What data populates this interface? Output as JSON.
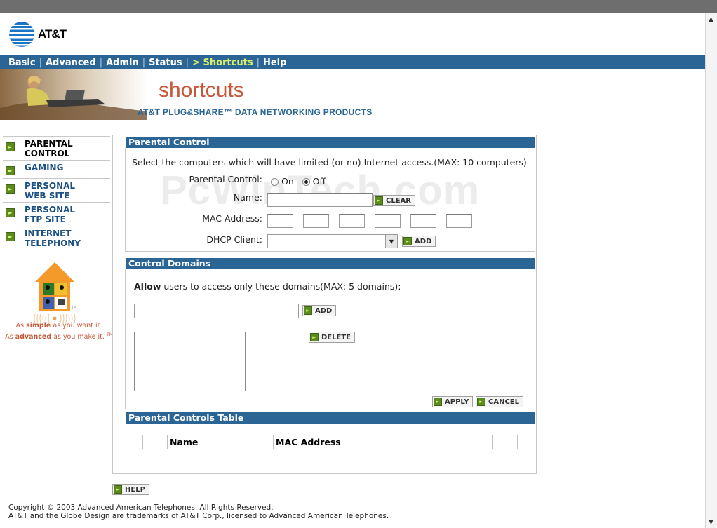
{
  "brand": {
    "logo_text": "AT&T",
    "logo_icon": "att-globe-icon"
  },
  "nav": {
    "items": [
      {
        "label": "Basic"
      },
      {
        "label": "Advanced"
      },
      {
        "label": "Admin"
      },
      {
        "label": "Status"
      },
      {
        "label": "> Shortcuts",
        "active": true
      },
      {
        "label": "Help"
      }
    ]
  },
  "banner": {
    "title": "shortcuts",
    "subtitle": "AT&T PLUG&SHARE™ DATA NETWORKING PRODUCTS"
  },
  "sidebar": {
    "items": [
      {
        "line1": "PARENTAL",
        "line2": "CONTROL",
        "active": true
      },
      {
        "line1": "GAMING",
        "line2": ""
      },
      {
        "line1": "PERSONAL",
        "line2": "WEB SITE"
      },
      {
        "line1": "PERSONAL",
        "line2": "FTP SITE"
      },
      {
        "line1": "INTERNET",
        "line2": "TELEPHONY"
      }
    ],
    "tagline": {
      "prefix1": "As ",
      "bold1": "simple",
      "suffix1": " as you want it.",
      "prefix2": "As ",
      "bold2": "advanced",
      "suffix2": " as you make it.",
      "tm": "TM"
    }
  },
  "parental_control": {
    "heading": "Parental Control",
    "description": "Select the computers which will have limited (or no) Internet access.(MAX: 10 computers)",
    "pc_label": "Parental Control:",
    "on_label": "On",
    "off_label": "Off",
    "selected": "Off",
    "name_label": "Name:",
    "name_value": "",
    "clear_label": "CLEAR",
    "mac_label": "MAC Address:",
    "mac_values": [
      "",
      "",
      "",
      "",
      "",
      ""
    ],
    "mac_separator": "-",
    "dhcp_label": "DHCP Client:",
    "dhcp_value": "",
    "add_label": "ADD"
  },
  "control_domains": {
    "heading": "Control Domains",
    "allow_bold": "Allow",
    "allow_rest": " users to access only these domains(MAX: 5 domains):",
    "domain_value": "",
    "add_label": "ADD",
    "delete_label": "DELETE",
    "apply_label": "APPLY",
    "cancel_label": "CANCEL"
  },
  "table": {
    "heading": "Parental Controls Table",
    "columns": [
      "",
      "Name",
      "MAC Address",
      ""
    ]
  },
  "help_label": "HELP",
  "watermark": "PcWinTech.com",
  "footer": {
    "line1": "Copyright © 2003 Advanced American Telephones. All Rights Reserved.",
    "line2": "AT&T and the Globe Design are trademarks of AT&T Corp., licensed to Advanced American Telephones."
  }
}
